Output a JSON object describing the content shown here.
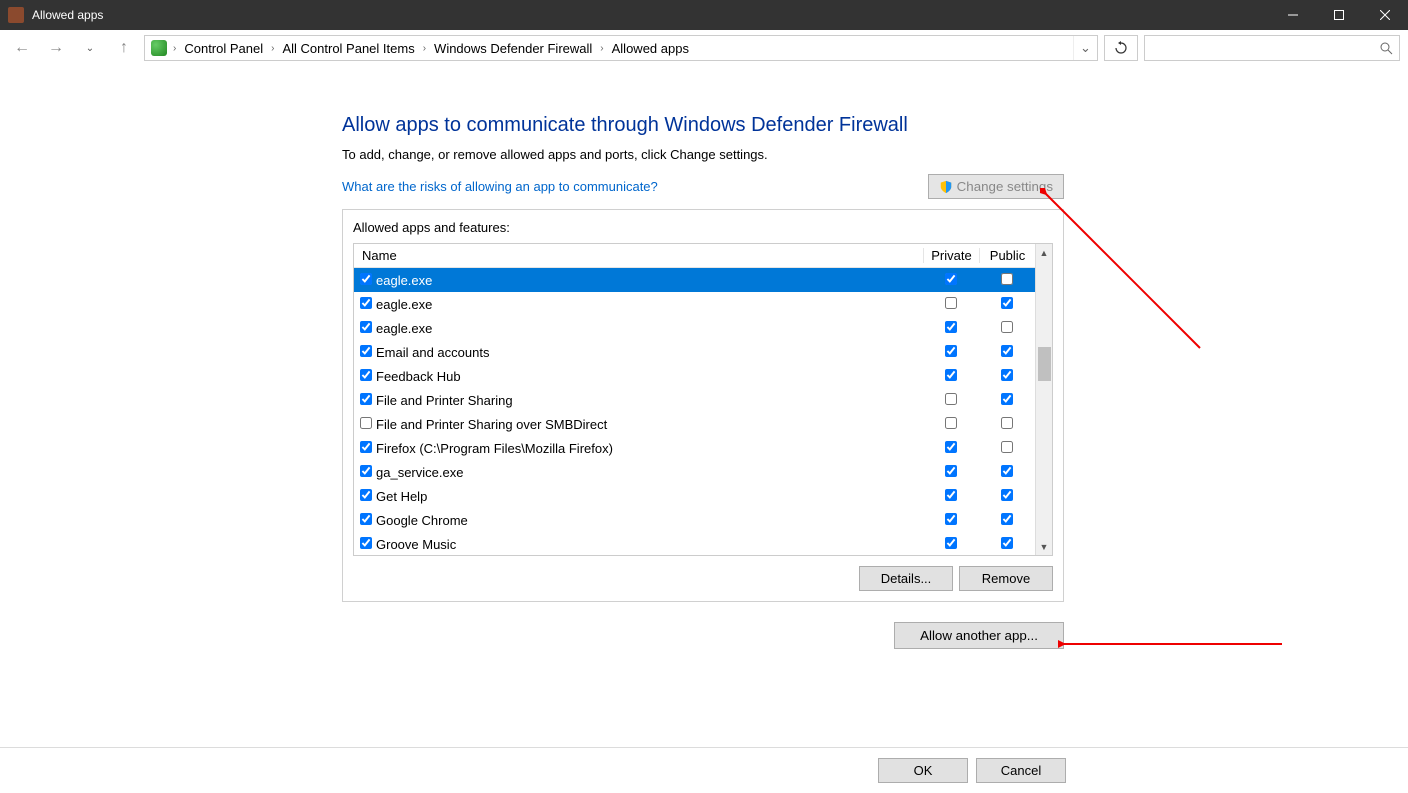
{
  "window": {
    "title": "Allowed apps"
  },
  "breadcrumbs": {
    "items": [
      "Control Panel",
      "All Control Panel Items",
      "Windows Defender Firewall",
      "Allowed apps"
    ]
  },
  "page": {
    "title": "Allow apps to communicate through Windows Defender Firewall",
    "subtitle": "To add, change, or remove allowed apps and ports, click Change settings.",
    "risks_link": "What are the risks of allowing an app to communicate?",
    "change_settings": "Change settings",
    "group_label": "Allowed apps and features:",
    "columns": {
      "name": "Name",
      "private": "Private",
      "public": "Public"
    },
    "rows": [
      {
        "enabled": true,
        "name": "eagle.exe",
        "private": true,
        "public": false,
        "selected": true
      },
      {
        "enabled": true,
        "name": "eagle.exe",
        "private": false,
        "public": true
      },
      {
        "enabled": true,
        "name": "eagle.exe",
        "private": true,
        "public": false
      },
      {
        "enabled": true,
        "name": "Email and accounts",
        "private": true,
        "public": true
      },
      {
        "enabled": true,
        "name": "Feedback Hub",
        "private": true,
        "public": true
      },
      {
        "enabled": true,
        "name": "File and Printer Sharing",
        "private": false,
        "public": true
      },
      {
        "enabled": false,
        "name": "File and Printer Sharing over SMBDirect",
        "private": false,
        "public": false
      },
      {
        "enabled": true,
        "name": "Firefox (C:\\Program Files\\Mozilla Firefox)",
        "private": true,
        "public": false
      },
      {
        "enabled": true,
        "name": "ga_service.exe",
        "private": true,
        "public": true
      },
      {
        "enabled": true,
        "name": "Get Help",
        "private": true,
        "public": true
      },
      {
        "enabled": true,
        "name": "Google Chrome",
        "private": true,
        "public": true
      },
      {
        "enabled": true,
        "name": "Groove Music",
        "private": true,
        "public": true
      }
    ],
    "details": "Details...",
    "remove": "Remove",
    "allow_another": "Allow another app..."
  },
  "footer": {
    "ok": "OK",
    "cancel": "Cancel"
  }
}
